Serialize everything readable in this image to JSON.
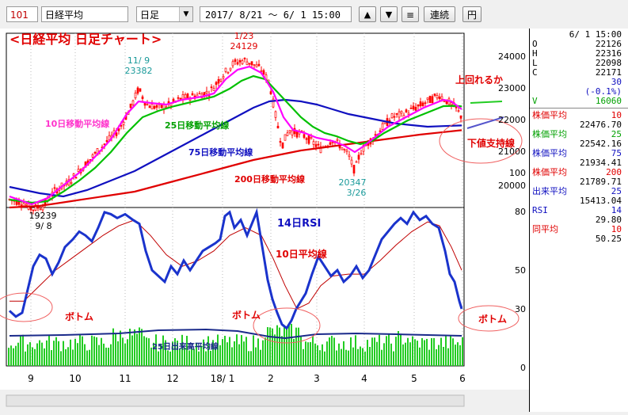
{
  "toolbar": {
    "code": "101",
    "name": "日経平均",
    "period": "日足",
    "range": "2017/ 8/21 〜  6/ 1 15:00",
    "up_icon": "▲",
    "down_icon": "▼",
    "menu_icon": "≡",
    "renzoku": "連続",
    "yen": "円"
  },
  "chart": {
    "title": "<日経平均 日足チャート>",
    "price_ticks": [
      "24000",
      "23000",
      "22000",
      "21000",
      "20000"
    ],
    "lower_ticks": [
      "100",
      "80",
      "50",
      "30",
      "0"
    ],
    "x_ticks": [
      "9",
      "10",
      "11",
      "12",
      "18/ 1",
      "2",
      "3",
      "4",
      "5",
      "6"
    ],
    "annotations": {
      "high_date": "1/23",
      "high_val": "24129",
      "nov_date": "11/ 9",
      "nov_val": "23382",
      "low_val": "20347",
      "low_date": "3/26",
      "sep_val": "19239",
      "sep_date": "9/ 8",
      "ma10": "10日移動平均線",
      "ma25": "25日移動平均線",
      "ma75": "75日移動平均線",
      "ma200": "200日移動平均線",
      "rsi": "14日RSI",
      "rsi_ma": "10日平均線",
      "vol_ma": "25日出来高平均線",
      "uwamawaru": "上回れるか",
      "shita": "下値支持線",
      "bottom1": "ボトム",
      "bottom2": "ボトム",
      "bottom3": "ボトム"
    },
    "colors": {
      "candle": "#ff0000",
      "ma10": "#ff00ff",
      "ma25": "#00c000",
      "ma75": "#1010c0",
      "ma200": "#e00000",
      "rsi": "#1a33cc",
      "rsi_ma": "#c00000",
      "volume": "#22cc22"
    }
  },
  "sidebar": {
    "date": "6/ 1 15:00",
    "o_label": "O",
    "o": "22126",
    "h_label": "H",
    "h": "22316",
    "l_label": "L",
    "l": "22098",
    "c_label": "C",
    "c": "22171",
    "chg": "30",
    "pct": "(-0.1%)",
    "v_label": "V",
    "v": "16060",
    "ind": [
      {
        "label": "株価平均",
        "period": "10",
        "value": "22476.70",
        "color": "#e00000"
      },
      {
        "label": "株価平均",
        "period": "25",
        "value": "22542.16",
        "color": "#00a000"
      },
      {
        "label": "株価平均",
        "period": "75",
        "value": "21934.41",
        "color": "#1010c0"
      },
      {
        "label": "株価平均",
        "period": "200",
        "value": "21789.71",
        "color": "#e00000"
      },
      {
        "label": "出来平均",
        "period": "25",
        "value": "15413.04",
        "color": "#1010c0"
      },
      {
        "label": "RSI",
        "period": "14",
        "value": "29.80",
        "color": "#1010c0"
      },
      {
        "label": "同平均",
        "period": "10",
        "value": "50.25",
        "color": "#e00000"
      }
    ]
  }
}
